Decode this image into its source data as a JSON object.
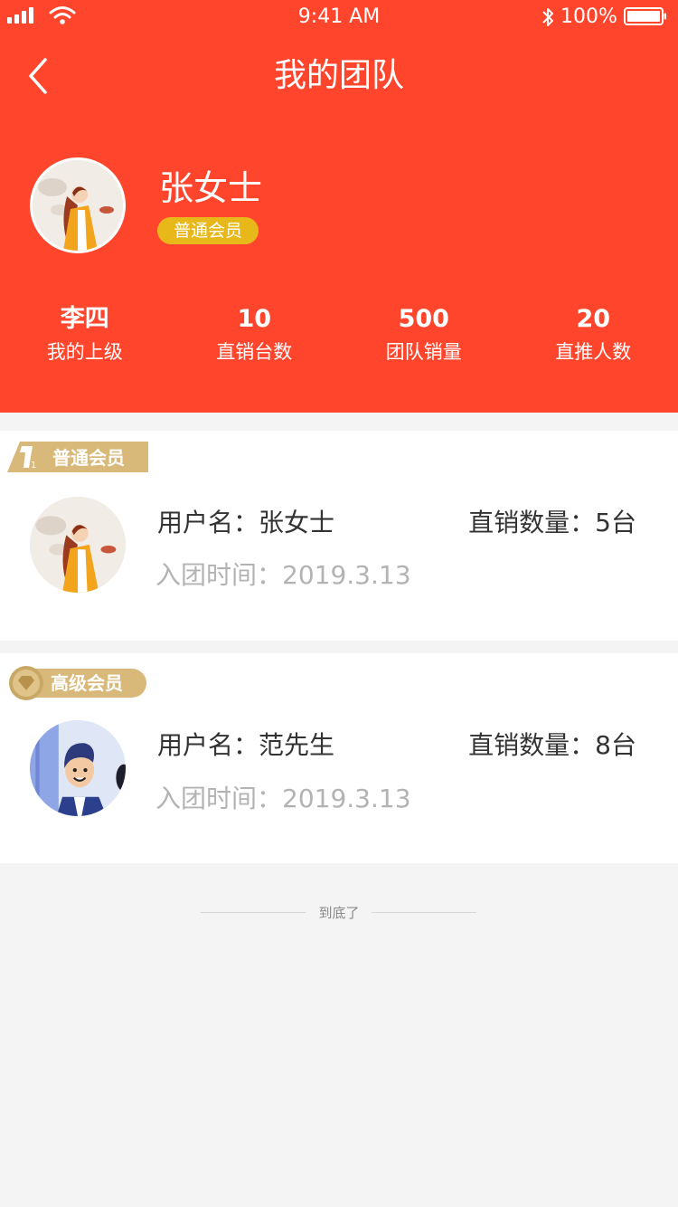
{
  "status_bar": {
    "time": "9:41 AM",
    "battery": "100%"
  },
  "nav": {
    "title": "我的团队"
  },
  "profile": {
    "name": "张女士",
    "badge": "普通会员"
  },
  "stats": [
    {
      "value": "李四",
      "label": "我的上级"
    },
    {
      "value": "10",
      "label": "直销台数"
    },
    {
      "value": "500",
      "label": "团队销量"
    },
    {
      "value": "20",
      "label": "直推人数"
    }
  ],
  "members": [
    {
      "tag": "普通会员",
      "username_label": "用户名：",
      "username": "张女士",
      "sales_label": "直销数量：",
      "sales": "5台",
      "join_label": "入团时间：",
      "join_date": "2019.3.13"
    },
    {
      "tag": "高级会员",
      "username_label": "用户名：",
      "username": "范先生",
      "sales_label": "直销数量：",
      "sales": "8台",
      "join_label": "入团时间：",
      "join_date": "2019.3.13"
    }
  ],
  "footer": {
    "end_text": "到底了"
  },
  "colors": {
    "header_bg": "#ff462d",
    "badge_yellow": "#e8b719",
    "tag_gold": "#d9b97a",
    "page_bg": "#f4f4f4"
  }
}
